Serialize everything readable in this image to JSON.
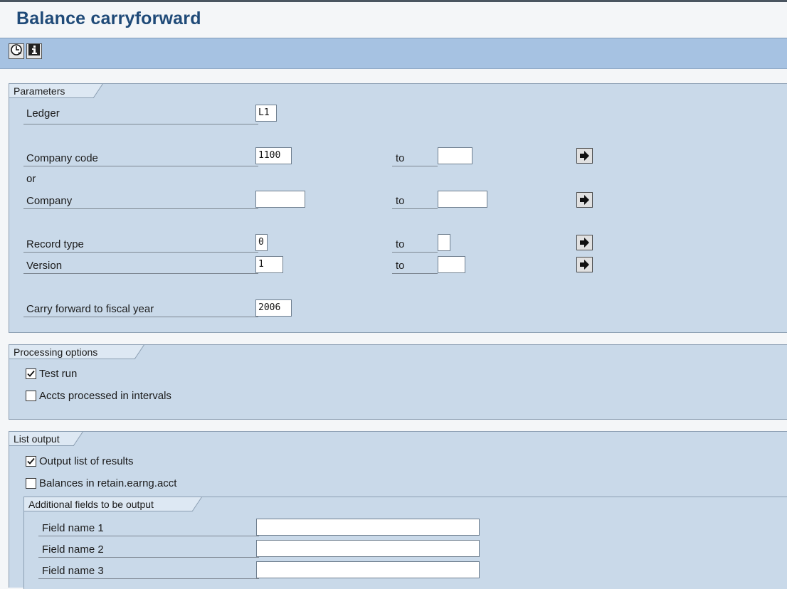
{
  "app": {
    "title": "Balance carryforward"
  },
  "toolbar": {
    "execute_icon": "clock-execute-icon",
    "info_icon": "info-icon"
  },
  "parameters": {
    "title": "Parameters",
    "ledger": {
      "label": "Ledger",
      "value": "L1"
    },
    "company_code": {
      "label": "Company code",
      "from": "1100",
      "to_label": "to",
      "to": ""
    },
    "or_label": "or",
    "company": {
      "label": "Company",
      "from": "",
      "to_label": "to",
      "to": ""
    },
    "record_type": {
      "label": "Record type",
      "from": "0",
      "to_label": "to",
      "to": ""
    },
    "version": {
      "label": "Version",
      "from": "1",
      "to_label": "to",
      "to": ""
    },
    "fiscal_year": {
      "label": "Carry forward to fiscal year",
      "value": "2006"
    }
  },
  "processing": {
    "title": "Processing options",
    "test_run": {
      "label": "Test run",
      "checked": true
    },
    "intervals": {
      "label": "Accts processed in intervals",
      "checked": false
    }
  },
  "list_output": {
    "title": "List output",
    "output_results": {
      "label": "Output list of results",
      "checked": true
    },
    "retain_earnings": {
      "label": "Balances in retain.earng.acct",
      "checked": false
    },
    "additional": {
      "title": "Additional fields to be output",
      "fields": [
        {
          "label": "Field name 1",
          "value": ""
        },
        {
          "label": "Field name 2",
          "value": ""
        },
        {
          "label": "Field name 3",
          "value": ""
        }
      ]
    }
  }
}
